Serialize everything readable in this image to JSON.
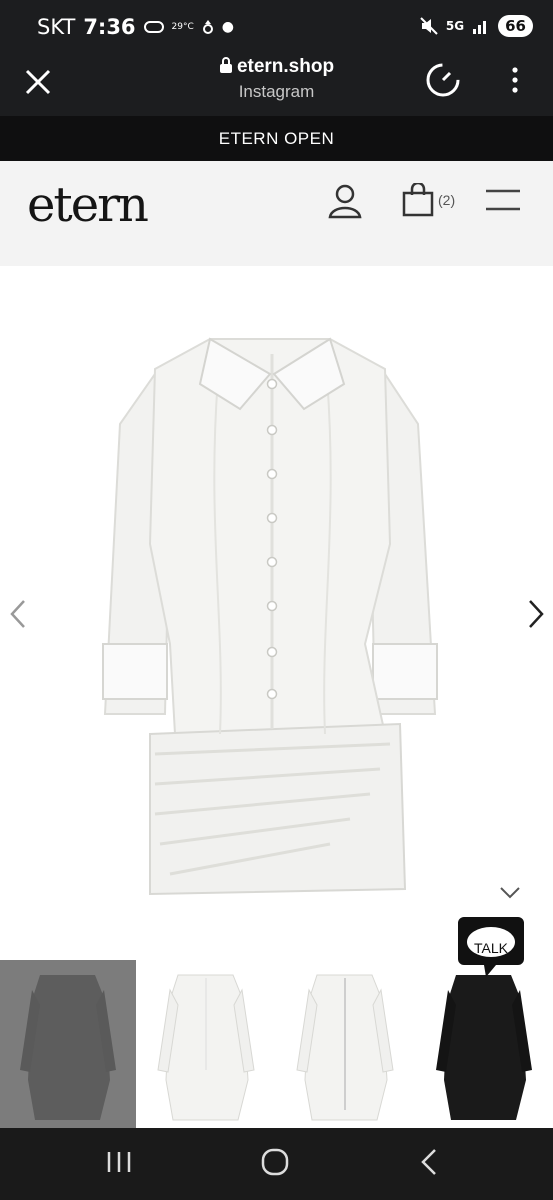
{
  "status": {
    "carrier": "SKT",
    "time": "7:36",
    "temp": "29°C",
    "network": "5G",
    "battery": "66"
  },
  "browser": {
    "url": "etern.shop",
    "source": "Instagram"
  },
  "announcement": "ETERN OPEN",
  "header": {
    "logo": "etern",
    "cart_count": "(2)"
  },
  "gallery": {
    "product_image": "white-shirt-mini-dress",
    "thumbnails": [
      {
        "name": "white-dress-front-grey"
      },
      {
        "name": "white-dress-front"
      },
      {
        "name": "white-dress-back"
      },
      {
        "name": "black-dress-front"
      }
    ]
  },
  "chat": {
    "label": "TALK"
  },
  "colors": {
    "chrome": "#1c1d1f",
    "announce": "#0f0f10",
    "header_bg": "#f3f3f3"
  }
}
